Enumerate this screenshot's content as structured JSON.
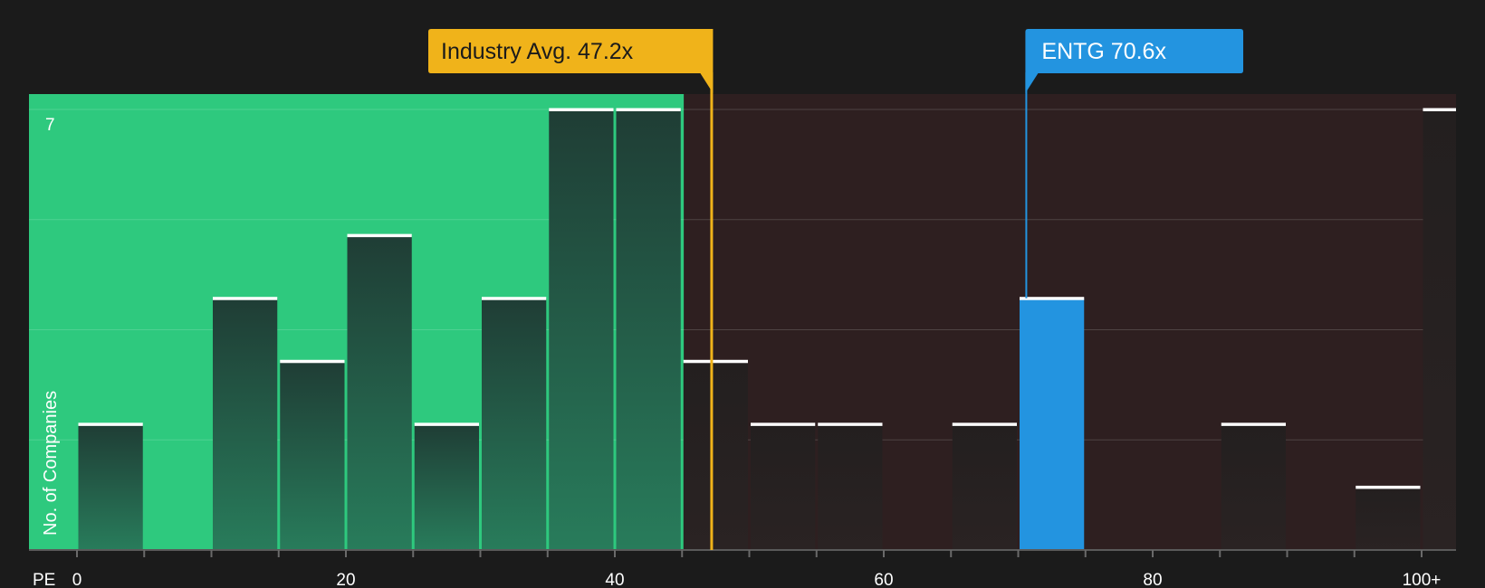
{
  "chart_data": {
    "type": "bar",
    "xlabel": "PE",
    "ylabel": "No. of Companies",
    "x_ticks": [
      "0",
      "20",
      "40",
      "60",
      "80",
      "100+"
    ],
    "y_tick_labels": [
      "7"
    ],
    "ylim": [
      0,
      7
    ],
    "xlim": [
      0,
      102.5
    ],
    "bin_width": 5,
    "grid": true,
    "series": [
      {
        "bins": [
          {
            "x_start": 0,
            "value": 2
          },
          {
            "x_start": 5,
            "value": 0
          },
          {
            "x_start": 10,
            "value": 4
          },
          {
            "x_start": 15,
            "value": 3
          },
          {
            "x_start": 20,
            "value": 5
          },
          {
            "x_start": 25,
            "value": 2
          },
          {
            "x_start": 30,
            "value": 4
          },
          {
            "x_start": 35,
            "value": 7
          },
          {
            "x_start": 40,
            "value": 7
          },
          {
            "x_start": 45,
            "value": 3
          },
          {
            "x_start": 50,
            "value": 2
          },
          {
            "x_start": 55,
            "value": 2
          },
          {
            "x_start": 60,
            "value": 0
          },
          {
            "x_start": 65,
            "value": 2
          },
          {
            "x_start": 70,
            "value": 4
          },
          {
            "x_start": 75,
            "value": 0
          },
          {
            "x_start": 80,
            "value": 0
          },
          {
            "x_start": 85,
            "value": 2
          },
          {
            "x_start": 90,
            "value": 0
          },
          {
            "x_start": 95,
            "value": 1
          },
          {
            "x_start": 100,
            "value": 7
          }
        ]
      }
    ],
    "highlight_bin_x_start": 70,
    "undervalued_region_end": 45,
    "annotations": [
      {
        "label": "Industry Avg. 47.2x",
        "value": 47.2
      },
      {
        "label": "ENTG 70.6x",
        "value": 70.6
      }
    ]
  },
  "colors": {
    "background": "#1b1b1b",
    "green_region": "#2ec97e",
    "red_region": "#2e1f20",
    "bar_in_green_top": "#20423a",
    "bar_in_green_bottom": "#28795a",
    "bar_in_red": "#262222",
    "highlight_bar": "#2394e0",
    "industry_avg": "#f0b31a",
    "company": "#2394e0",
    "bar_cap": "#ffffff"
  }
}
